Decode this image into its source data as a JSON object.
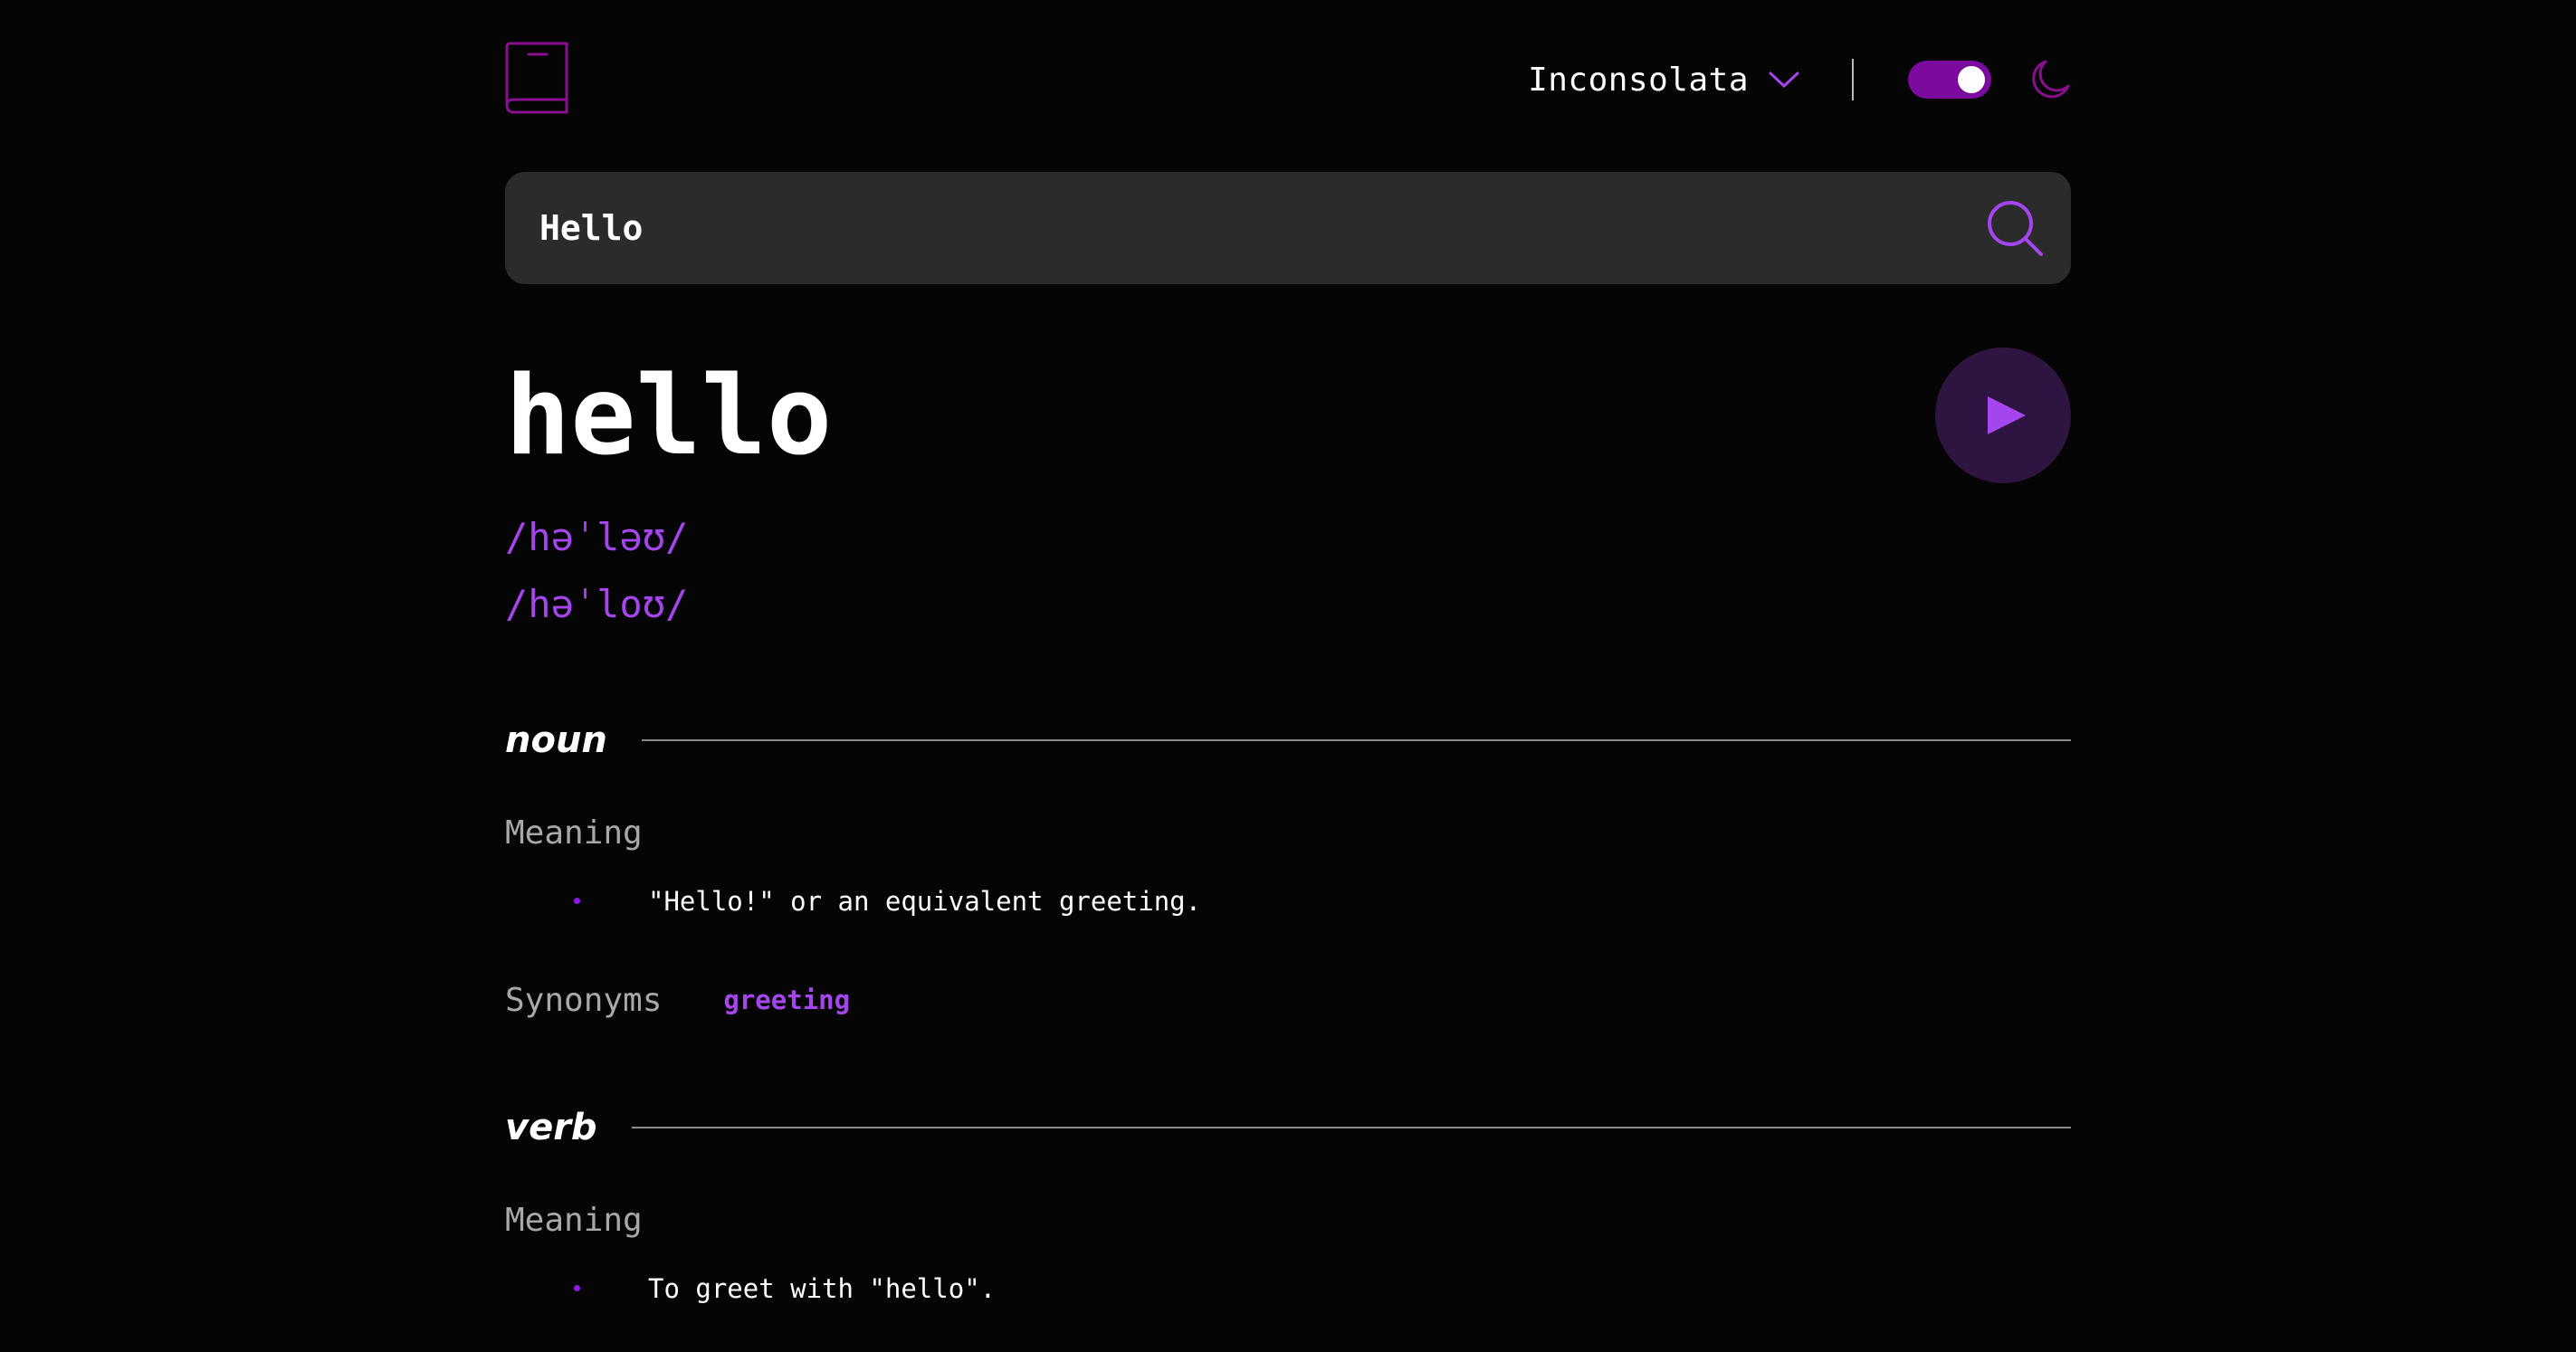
{
  "header": {
    "logo_icon": "book-icon",
    "font_select": {
      "selected": "Inconsolata",
      "chevron_icon": "chevron-down-icon"
    },
    "theme_toggle": {
      "state": "dark",
      "on": true,
      "moon_icon": "moon-icon"
    }
  },
  "search": {
    "value": "Hello",
    "icon": "search-icon"
  },
  "entry": {
    "word": "hello",
    "phonetics": [
      "/həˈləʊ/",
      "/həˈloʊ/"
    ],
    "play_icon": "play-icon",
    "meanings": [
      {
        "part_of_speech": "noun",
        "heading": "Meaning",
        "definitions": [
          "\"Hello!\" or an equivalent greeting."
        ],
        "synonyms_label": "Synonyms",
        "synonyms": [
          "greeting"
        ]
      },
      {
        "part_of_speech": "verb",
        "heading": "Meaning",
        "definitions": [
          "To greet with \"hello\"."
        ]
      }
    ]
  },
  "colors": {
    "background": "#050505",
    "accent": "#a445ed",
    "toggle": "#7c0a9e",
    "search_bg": "#2b2b2b",
    "play_bg": "#2e1441",
    "muted_text": "#a8a8a8",
    "divider": "#8a8a8a"
  }
}
